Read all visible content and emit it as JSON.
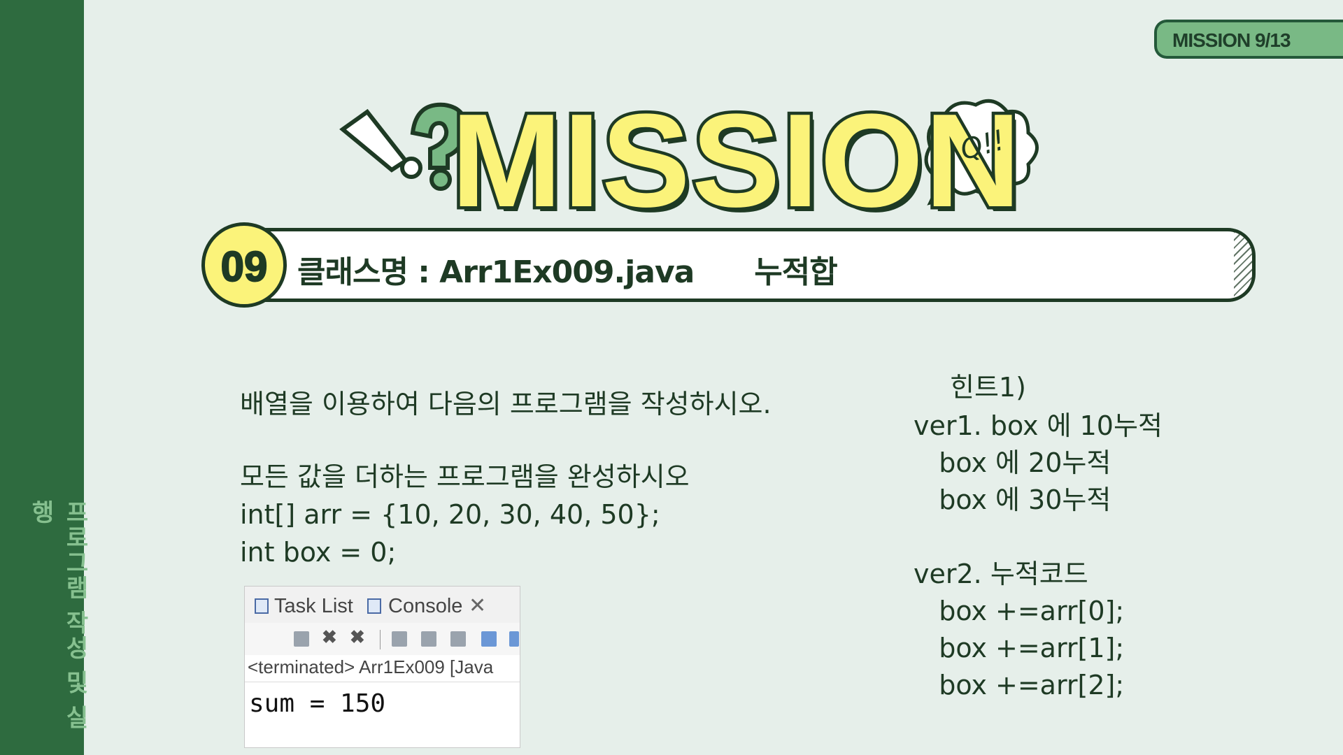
{
  "sidebar": {
    "vertical_label": "프로그램 작성 및 실행"
  },
  "badge": {
    "text": "MISSION 9/13"
  },
  "title": {
    "text": "MISSION",
    "bubble_text": "Q!!"
  },
  "header": {
    "number": "09",
    "class_label": "클래스명 : Arr1Ex009.java      누적합"
  },
  "problem": {
    "line1": "배열을 이용하여 다음의 프로그램을 작성하시오.",
    "line2": "모든 값을 더하는 프로그램을 완성하시오",
    "line3": "int[] arr = {10, 20, 30, 40, 50};",
    "line4": "int box = 0;"
  },
  "hint": {
    "title": "힌트1)",
    "lines": [
      "ver1. box 에 10누적",
      "   box 에 20누적",
      "   box 에 30누적",
      "",
      "ver2. 누적코드",
      "   box +=arr[0];",
      "   box +=arr[1];",
      "   box +=arr[2];"
    ]
  },
  "console": {
    "tab_task": "Task List",
    "tab_console": "Console",
    "close": "✕",
    "terminated": "<terminated> Arr1Ex009 [Java",
    "output": "sum = 150"
  },
  "colors": {
    "sidebar": "#2e6b3f",
    "accent_yellow": "#fbf37a",
    "dark_green": "#1e3a24",
    "badge": "#79b985"
  }
}
